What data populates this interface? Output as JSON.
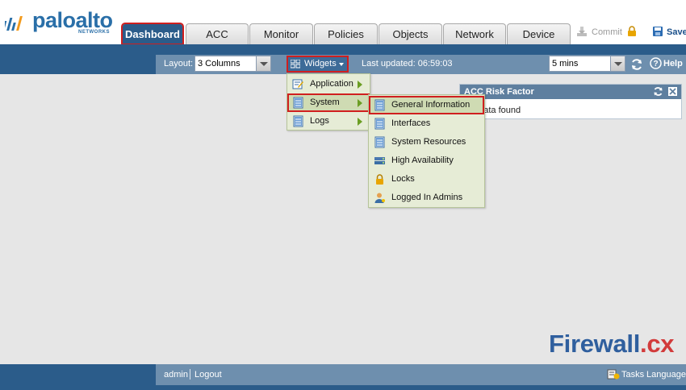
{
  "brand": {
    "name": "paloalto",
    "sub": "NETWORKS",
    "colors": {
      "brand_blue": "#2a6fa8",
      "accent_orange": "#f39a1c"
    }
  },
  "tabs": [
    {
      "label": "Dashboard",
      "active": true
    },
    {
      "label": "ACC",
      "active": false
    },
    {
      "label": "Monitor",
      "active": false
    },
    {
      "label": "Policies",
      "active": false
    },
    {
      "label": "Objects",
      "active": false
    },
    {
      "label": "Network",
      "active": false
    },
    {
      "label": "Device",
      "active": false
    }
  ],
  "actions": {
    "commit_label": "Commit",
    "save_label": "Save"
  },
  "toolbar": {
    "layout_label": "Layout:",
    "layout_value": "3 Columns",
    "widgets_label": "Widgets",
    "last_updated_label": "Last updated:",
    "last_updated_value": "06:59:03",
    "refresh_value": "5 mins",
    "help_label": "Help"
  },
  "widget_menu": {
    "items": [
      {
        "label": "Application",
        "icon": "application-icon",
        "has_submenu": true
      },
      {
        "label": "System",
        "icon": "system-icon",
        "has_submenu": true
      },
      {
        "label": "Logs",
        "icon": "logs-icon",
        "has_submenu": true
      }
    ]
  },
  "system_submenu": {
    "items": [
      {
        "label": "General Information",
        "icon": "document-icon"
      },
      {
        "label": "Interfaces",
        "icon": "document-icon"
      },
      {
        "label": "System Resources",
        "icon": "document-icon"
      },
      {
        "label": "High Availability",
        "icon": "cluster-icon"
      },
      {
        "label": "Locks",
        "icon": "lock-icon"
      },
      {
        "label": "Logged In Admins",
        "icon": "user-icon"
      }
    ]
  },
  "risk_panel": {
    "title": "ACC Risk Factor",
    "body": "No data found"
  },
  "footer": {
    "user": "admin",
    "logout_label": "Logout",
    "tasks_label": "Tasks",
    "language_label": "Language"
  },
  "watermark": {
    "text": "Firewall",
    "suffix": ".cx"
  }
}
